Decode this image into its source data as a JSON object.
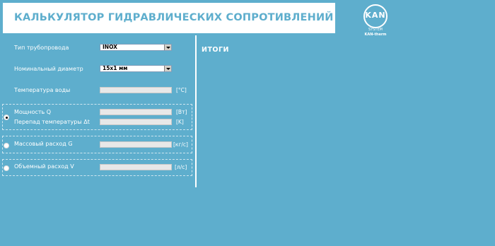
{
  "header": {
    "title": "КАЛЬКУЛЯТОР ГИДРАВЛИЧЕСКИХ СОПРОТИВЛЕНИЙ"
  },
  "logo": {
    "brand": "KAN",
    "system": "SYSTEM",
    "product": "KAN-therm"
  },
  "form": {
    "pipe_type": {
      "label": "Тип трубопровода",
      "value": "INOX"
    },
    "diameter": {
      "label": "Номинальный диаметр",
      "value": "15x1 мм"
    },
    "water_temp": {
      "label": "Температура воды",
      "unit": "[°C]"
    },
    "power": {
      "label": "Мощность Q",
      "unit": "[Вт]",
      "selected": true
    },
    "temp_diff": {
      "label": "Перепад температуры Δt",
      "unit": "[K]"
    },
    "mass_flow": {
      "label": "Массовый расход G",
      "unit": "[кг/с]",
      "selected": false
    },
    "volume_flow": {
      "label": "Объемный расход V",
      "unit": "[л/с]",
      "selected": false
    }
  },
  "results": {
    "title": "ИТОГИ"
  },
  "colors": {
    "background": "#5eaecd",
    "panel": "#ffffff",
    "accent": "#5eaecd"
  }
}
